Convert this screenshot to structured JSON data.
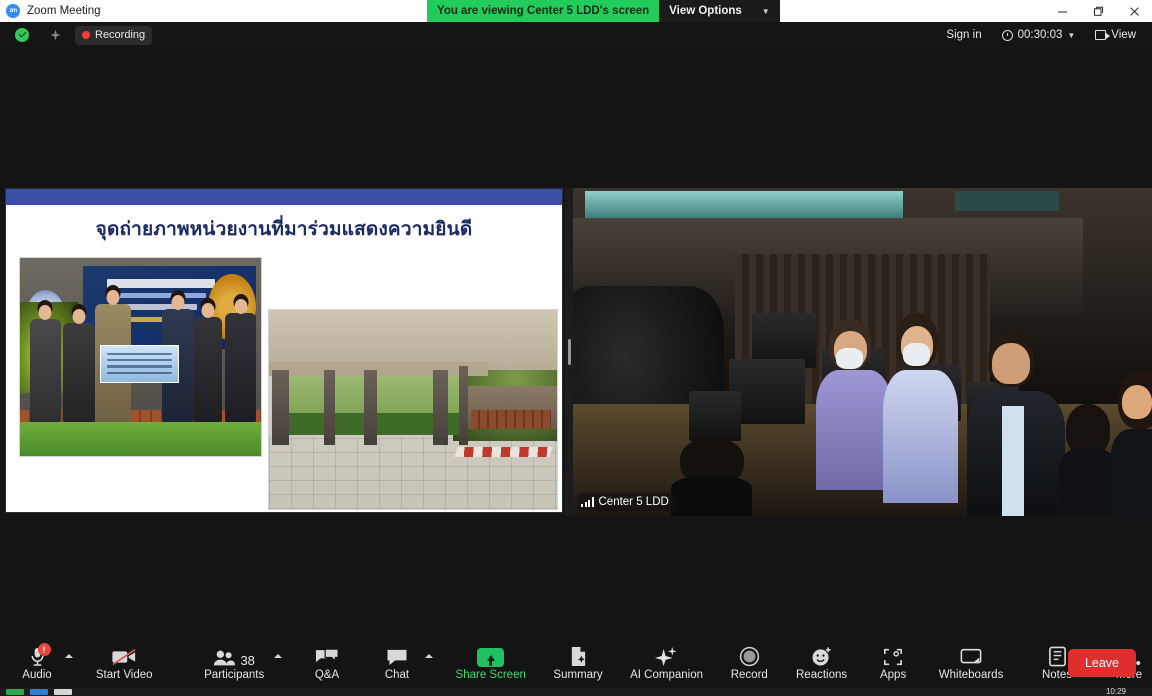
{
  "window": {
    "app_icon": "zoom-logo-icon",
    "title": "Zoom Meeting",
    "controls": {
      "minimize": "minimize-icon",
      "maximize": "restore-icon",
      "close": "close-icon"
    }
  },
  "share_banner": {
    "text": "You are viewing Center 5 LDD's screen",
    "view_options_label": "View Options",
    "caret": "⌄",
    "green": "#22cc5a"
  },
  "topbar": {
    "encryption_icon": "shield-check-icon",
    "sparkle_icon": "ai-sparkle-icon",
    "recording_label": "Recording",
    "recording_dot_color": "#ed3b3b",
    "sign_in_label": "Sign in",
    "timer": "00:30:03",
    "timer_caret": "⌄",
    "view_label": "View"
  },
  "shared_screen": {
    "slide_title": "จุดถ่ายภาพหน่วยงานที่มาร่วมแสดงความยินดี",
    "accent_color": "#3b4fa8",
    "photos": [
      {
        "name": "group-ceremony-photo",
        "caption": ""
      },
      {
        "name": "building-walkway-photo",
        "caption": ""
      }
    ]
  },
  "video_tile": {
    "participant_name": "Center 5 LDD",
    "signal_icon": "signal-bars-icon"
  },
  "toolbar": {
    "items": [
      {
        "name": "audio",
        "label": "Audio",
        "icon": "microphone-muted-icon",
        "badge": "!",
        "caret": true,
        "green": false
      },
      {
        "name": "start-video",
        "label": "Start Video",
        "icon": "video-off-icon",
        "badge": "",
        "caret": false,
        "green": false
      },
      {
        "name": "participants",
        "label": "Participants",
        "icon": "people-icon",
        "badge": "",
        "caret": true,
        "green": false,
        "count": "38"
      },
      {
        "name": "qa",
        "label": "Q&A",
        "icon": "chat-bubbles-icon",
        "badge": "",
        "caret": false,
        "green": false
      },
      {
        "name": "chat",
        "label": "Chat",
        "icon": "chat-bubble-icon",
        "badge": "",
        "caret": true,
        "green": false
      },
      {
        "name": "share-screen",
        "label": "Share Screen",
        "icon": "share-screen-icon",
        "badge": "",
        "caret": false,
        "green": true
      },
      {
        "name": "summary",
        "label": "Summary",
        "icon": "summary-doc-icon",
        "badge": "",
        "caret": false,
        "green": false
      },
      {
        "name": "ai-companion",
        "label": "AI Companion",
        "icon": "sparkle-icon",
        "badge": "",
        "caret": false,
        "green": false
      },
      {
        "name": "record",
        "label": "Record",
        "icon": "record-circle-icon",
        "badge": "",
        "caret": false,
        "green": false
      },
      {
        "name": "reactions",
        "label": "Reactions",
        "icon": "smiley-plus-icon",
        "badge": "",
        "caret": false,
        "green": false
      },
      {
        "name": "apps",
        "label": "Apps",
        "icon": "apps-icon",
        "badge": "",
        "caret": false,
        "green": false
      },
      {
        "name": "whiteboards",
        "label": "Whiteboards",
        "icon": "whiteboard-icon",
        "badge": "",
        "caret": false,
        "green": false
      },
      {
        "name": "notes",
        "label": "Notes",
        "icon": "notes-icon",
        "badge": "",
        "caret": false,
        "green": false
      },
      {
        "name": "more",
        "label": "More",
        "icon": "ellipsis-icon",
        "badge": "",
        "caret": false,
        "green": false
      }
    ],
    "participants_count": "38",
    "leave_label": "Leave",
    "leave_color": "#e02d2d"
  },
  "taskbar": {
    "time": "10:29"
  }
}
